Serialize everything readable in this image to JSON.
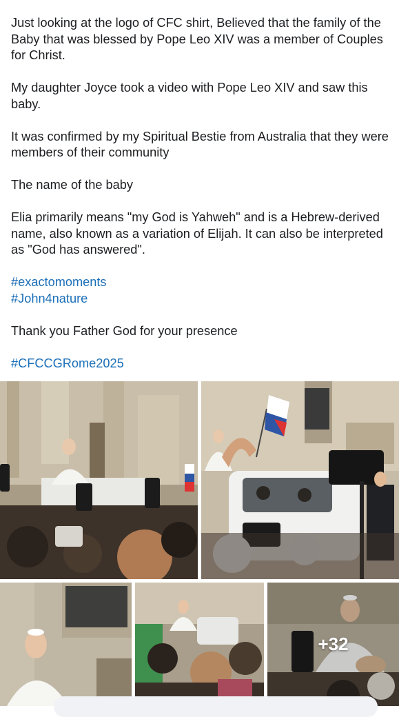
{
  "post": {
    "paragraphs": [
      "Just looking at the logo of CFC shirt, Believed that the family of the Baby that was blessed by Pope Leo XIV was a member of Couples for Christ.",
      "My daughter Joyce took a video with Pope Leo XIV and saw this baby.",
      "It was confirmed by my Spiritual Bestie from Australia that they were members of their community",
      "The name of the baby",
      "Elia primarily means \"my God is Yahweh\" and is a Hebrew-derived name, also known as a variation of Elijah. It can also be interpreted as \"God has answered\"."
    ],
    "hashtags_group": [
      "#exactomoments",
      "#John4nature"
    ],
    "closing": "Thank you Father God for your presence",
    "final_hashtag": "#CFCCGRome2025"
  },
  "gallery": {
    "more_photos_label": "+32",
    "photo_count_visible": 5
  },
  "colors": {
    "text": "#1c1e21",
    "hashtag": "#1b6fb8",
    "background": "#ffffff"
  }
}
